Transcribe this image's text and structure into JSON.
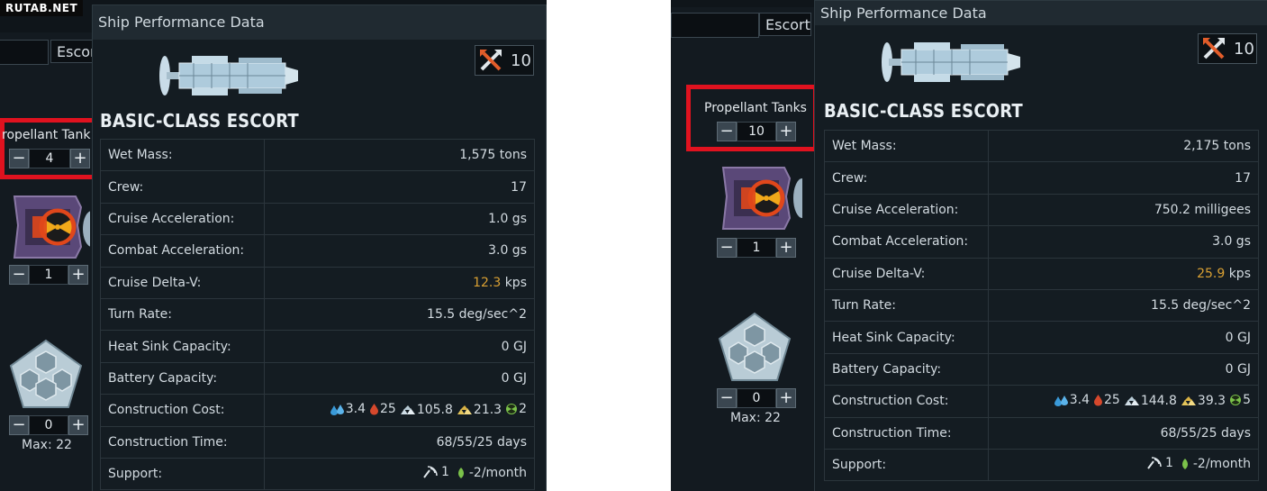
{
  "watermark": "RUTAB.NET",
  "left": {
    "escort_tab": "Escor",
    "propellant_label": "ropellant Tank",
    "propellant_value": "4",
    "module_value": "1",
    "armor_value": "0",
    "max_label": "Max: 22",
    "popup": {
      "title": "Ship Performance Data",
      "combat_value": "10",
      "ship_name": "BASIC-CLASS ESCORT",
      "stats": [
        {
          "key": "Wet Mass:",
          "value": "1,575 tons"
        },
        {
          "key": "Crew:",
          "value": "17"
        },
        {
          "key": "Cruise Acceleration:",
          "value": "1.0 gs"
        },
        {
          "key": "Combat Acceleration:",
          "value": "3.0 gs"
        },
        {
          "key": "Cruise Delta-V:",
          "value_highlight": "12.3",
          "value_unit": " kps"
        },
        {
          "key": "Turn Rate:",
          "value": "15.5 deg/sec^2"
        },
        {
          "key": "Heat Sink Capacity:",
          "value": "0 GJ"
        },
        {
          "key": "Battery Capacity:",
          "value": "0 GJ"
        },
        {
          "key": "Construction Cost:",
          "water": "3.4",
          "volatiles": "25",
          "metals": "105.8",
          "nobles": "21.3",
          "fissiles": "2"
        },
        {
          "key": "Construction Time:",
          "value": "68/55/25 days"
        },
        {
          "key": "Support:",
          "support_count": "1",
          "support_rate": "-2/month"
        }
      ]
    }
  },
  "right": {
    "escort_tab": "Escort",
    "propellant_label": "Propellant Tanks",
    "propellant_value": "10",
    "module_value": "1",
    "armor_value": "0",
    "max_label": "Max: 22",
    "popup": {
      "title": "Ship Performance Data",
      "combat_value": "10",
      "ship_name": "BASIC-CLASS ESCORT",
      "stats": [
        {
          "key": "Wet Mass:",
          "value": "2,175 tons"
        },
        {
          "key": "Crew:",
          "value": "17"
        },
        {
          "key": "Cruise Acceleration:",
          "value": "750.2 milligees"
        },
        {
          "key": "Combat Acceleration:",
          "value": "3.0 gs"
        },
        {
          "key": "Cruise Delta-V:",
          "value_highlight": "25.9",
          "value_unit": " kps"
        },
        {
          "key": "Turn Rate:",
          "value": "15.5 deg/sec^2"
        },
        {
          "key": "Heat Sink Capacity:",
          "value": "0 GJ"
        },
        {
          "key": "Battery Capacity:",
          "value": "0 GJ"
        },
        {
          "key": "Construction Cost:",
          "water": "3.4",
          "volatiles": "25",
          "metals": "144.8",
          "nobles": "39.3",
          "fissiles": "5"
        },
        {
          "key": "Construction Time:",
          "value": "68/55/25 days"
        },
        {
          "key": "Support:",
          "support_count": "1",
          "support_rate": "-2/month"
        }
      ]
    }
  },
  "symbols": {
    "minus": "−",
    "plus": "+"
  },
  "colors": {
    "highlight_red": "#e0121f",
    "delta_v_gold": "#d9a033",
    "water_blue": "#3a9ad9",
    "volatiles_red": "#d6482c",
    "fissile_green": "#7bc24a"
  }
}
